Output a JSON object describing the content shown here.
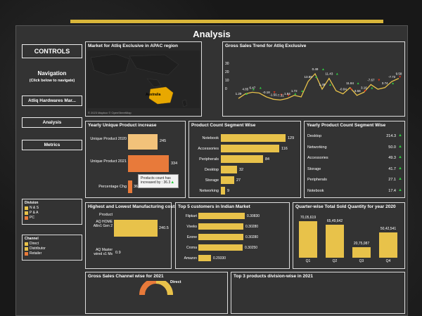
{
  "title": "Analysis",
  "controls": {
    "heading": "CONTROLS",
    "nav_title": "Navigation",
    "nav_subtitle": "(Click below to navigate)",
    "buttons": [
      "Atliq Hardwares Mar...",
      "Analysis",
      "Metrics"
    ]
  },
  "legend_division": {
    "title": "Division",
    "items": [
      {
        "label": "N & S",
        "color": "#e8c24a"
      },
      {
        "label": "P & A",
        "color": "#e8c24a"
      },
      {
        "label": "PC",
        "color": "#e87a3a"
      }
    ]
  },
  "legend_channel": {
    "title": "Channel",
    "items": [
      {
        "label": "Direct",
        "color": "#e8c24a"
      },
      {
        "label": "Distributor",
        "color": "#e8c24a"
      },
      {
        "label": "Retailer",
        "color": "#e87a3a"
      }
    ]
  },
  "map": {
    "title": "Market for Atliq Exclusive in APAC region",
    "region_label": "Australia",
    "credit": "© 2023 Mapbox © OpenStreetMap"
  },
  "trend": {
    "title": "Gross Sales Trend for Atliq Exclusive",
    "y_ticks": [
      "30",
      "20",
      "10",
      "0"
    ],
    "point_labels": [
      "1.29",
      "4.85",
      "6.47",
      "-0.18",
      "-1.50",
      "-7.31",
      "1.84",
      "1.72",
      "13.89",
      "0.49",
      "1.49",
      "11.43",
      "-0.84",
      "11.84",
      "-3.58",
      "3.16",
      "-7.67",
      "3.74",
      "-7.72",
      "9.58"
    ]
  },
  "yearly_unique": {
    "title": "Yearly Unique Product increase",
    "rows": [
      {
        "label": "Unique Product 2020",
        "value": "245"
      },
      {
        "label": "Unique Product 2021",
        "value": "334"
      },
      {
        "label": "Percentage Chg",
        "value": "36.3"
      }
    ],
    "tooltip_line1": "Products count has",
    "tooltip_line2": "increased by : 36.3"
  },
  "segment_count": {
    "title": "Product Count Segment Wise",
    "rows": [
      {
        "label": "Notebook",
        "value": "129"
      },
      {
        "label": "Accessories",
        "value": "116"
      },
      {
        "label": "Peripherals",
        "value": "84"
      },
      {
        "label": "Desktop",
        "value": "32"
      },
      {
        "label": "Storage",
        "value": "27"
      },
      {
        "label": "Networking",
        "value": "9"
      }
    ]
  },
  "yearly_segment": {
    "title": "Yearly Product Count Segment Wise",
    "rows": [
      {
        "label": "Desktop",
        "value": "214.3"
      },
      {
        "label": "Networking",
        "value": "50.0"
      },
      {
        "label": "Accessories",
        "value": "49.3"
      },
      {
        "label": "Storage",
        "value": "41.7"
      },
      {
        "label": "Peripherals",
        "value": "27.1"
      },
      {
        "label": "Notebook",
        "value": "17.4"
      }
    ]
  },
  "manufacturing": {
    "title": "Highest and Lowest Manufacturing costs",
    "col_label": "Product",
    "rows": [
      {
        "label": "AQ HOME Allin1 Gen 2",
        "value": "240.5"
      },
      {
        "label": "AQ Master wired x1 Ms",
        "value": "0.9"
      }
    ]
  },
  "top5": {
    "title": "Top 5 customers in Indian Market",
    "rows": [
      {
        "label": "Flipkart",
        "value": "0.30830"
      },
      {
        "label": "Viveks",
        "value": "0.30280"
      },
      {
        "label": "Ezone",
        "value": "0.30280"
      },
      {
        "label": "Croma",
        "value": "0.30250"
      },
      {
        "label": "Amazon",
        "value": "0.29330"
      }
    ]
  },
  "quarter": {
    "title": "Quarter-wise Total Sold Quantity for year 2020",
    "bars": [
      {
        "label": "Q1",
        "value": "70,05,619"
      },
      {
        "label": "Q2",
        "value": "65,49,642"
      },
      {
        "label": "Q3",
        "value": "20,75,087"
      },
      {
        "label": "Q4",
        "value": "50,42,541"
      }
    ]
  },
  "channel": {
    "title": "Gross Sales Channel wise for 2021",
    "label": "Direct"
  },
  "top3": {
    "title": "Top 3 products division-wise in 2021"
  },
  "colors": {
    "accent": "#e8c24a",
    "orange": "#e87a3a",
    "peach": "#f2c27a",
    "up": "#2ecc40",
    "down": "#e0331a"
  }
}
